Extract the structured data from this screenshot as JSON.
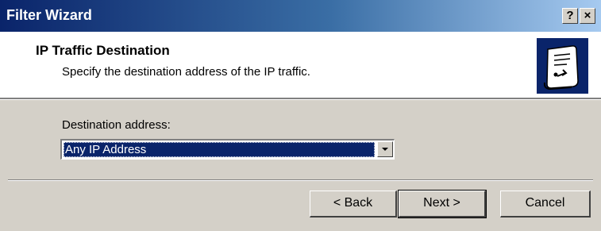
{
  "window": {
    "title": "Filter Wizard",
    "help_label": "?",
    "close_label": "×"
  },
  "header": {
    "title": "IP Traffic Destination",
    "subtitle": "Specify the destination address of the IP traffic."
  },
  "form": {
    "destination_label": "Destination address:",
    "destination_value": "Any IP Address"
  },
  "buttons": {
    "back": "< Back",
    "next": "Next >",
    "cancel": "Cancel"
  },
  "colors": {
    "titlebar": "#0a246a",
    "selection": "#0a246a",
    "face": "#d4d0c8"
  }
}
